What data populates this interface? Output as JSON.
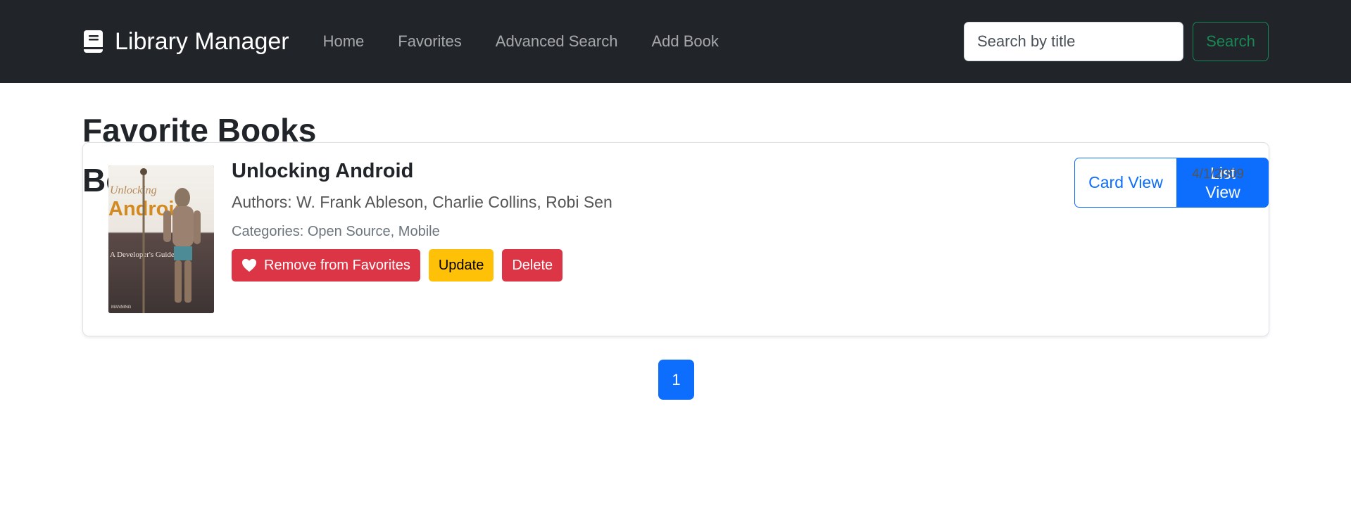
{
  "navbar": {
    "brand_bold": "Library",
    "brand_light": "Manager",
    "links": [
      "Home",
      "Favorites",
      "Advanced Search",
      "Add Book"
    ],
    "search": {
      "placeholder": "Search by title",
      "button_label": "Search"
    }
  },
  "main": {
    "page_title": "Favorite Books",
    "section_title": "Books",
    "view_toggle": {
      "card_label": "Card View",
      "list_label": "List View",
      "active": "List View"
    }
  },
  "books": [
    {
      "title": "Unlocking Android",
      "date": "4/1/2009",
      "authors": "Authors: W. Frank Ableson, Charlie Collins, Robi Sen",
      "categories": "Categories: Open Source, Mobile",
      "cover": {
        "line1": "Unlocking",
        "line2": "Android",
        "line3": "A Developer's Guide",
        "line4": "MANNING"
      },
      "actions": {
        "favorite": "Remove from Favorites",
        "update": "Update",
        "delete": "Delete"
      }
    }
  ],
  "pagination": {
    "current": "1"
  },
  "colors": {
    "navbar_bg": "#212529",
    "primary": "#0d6efd",
    "danger": "#dc3545",
    "warning": "#ffc107",
    "success": "#198754"
  },
  "icons": {
    "brand": "book-icon",
    "favorite": "heart-icon"
  }
}
